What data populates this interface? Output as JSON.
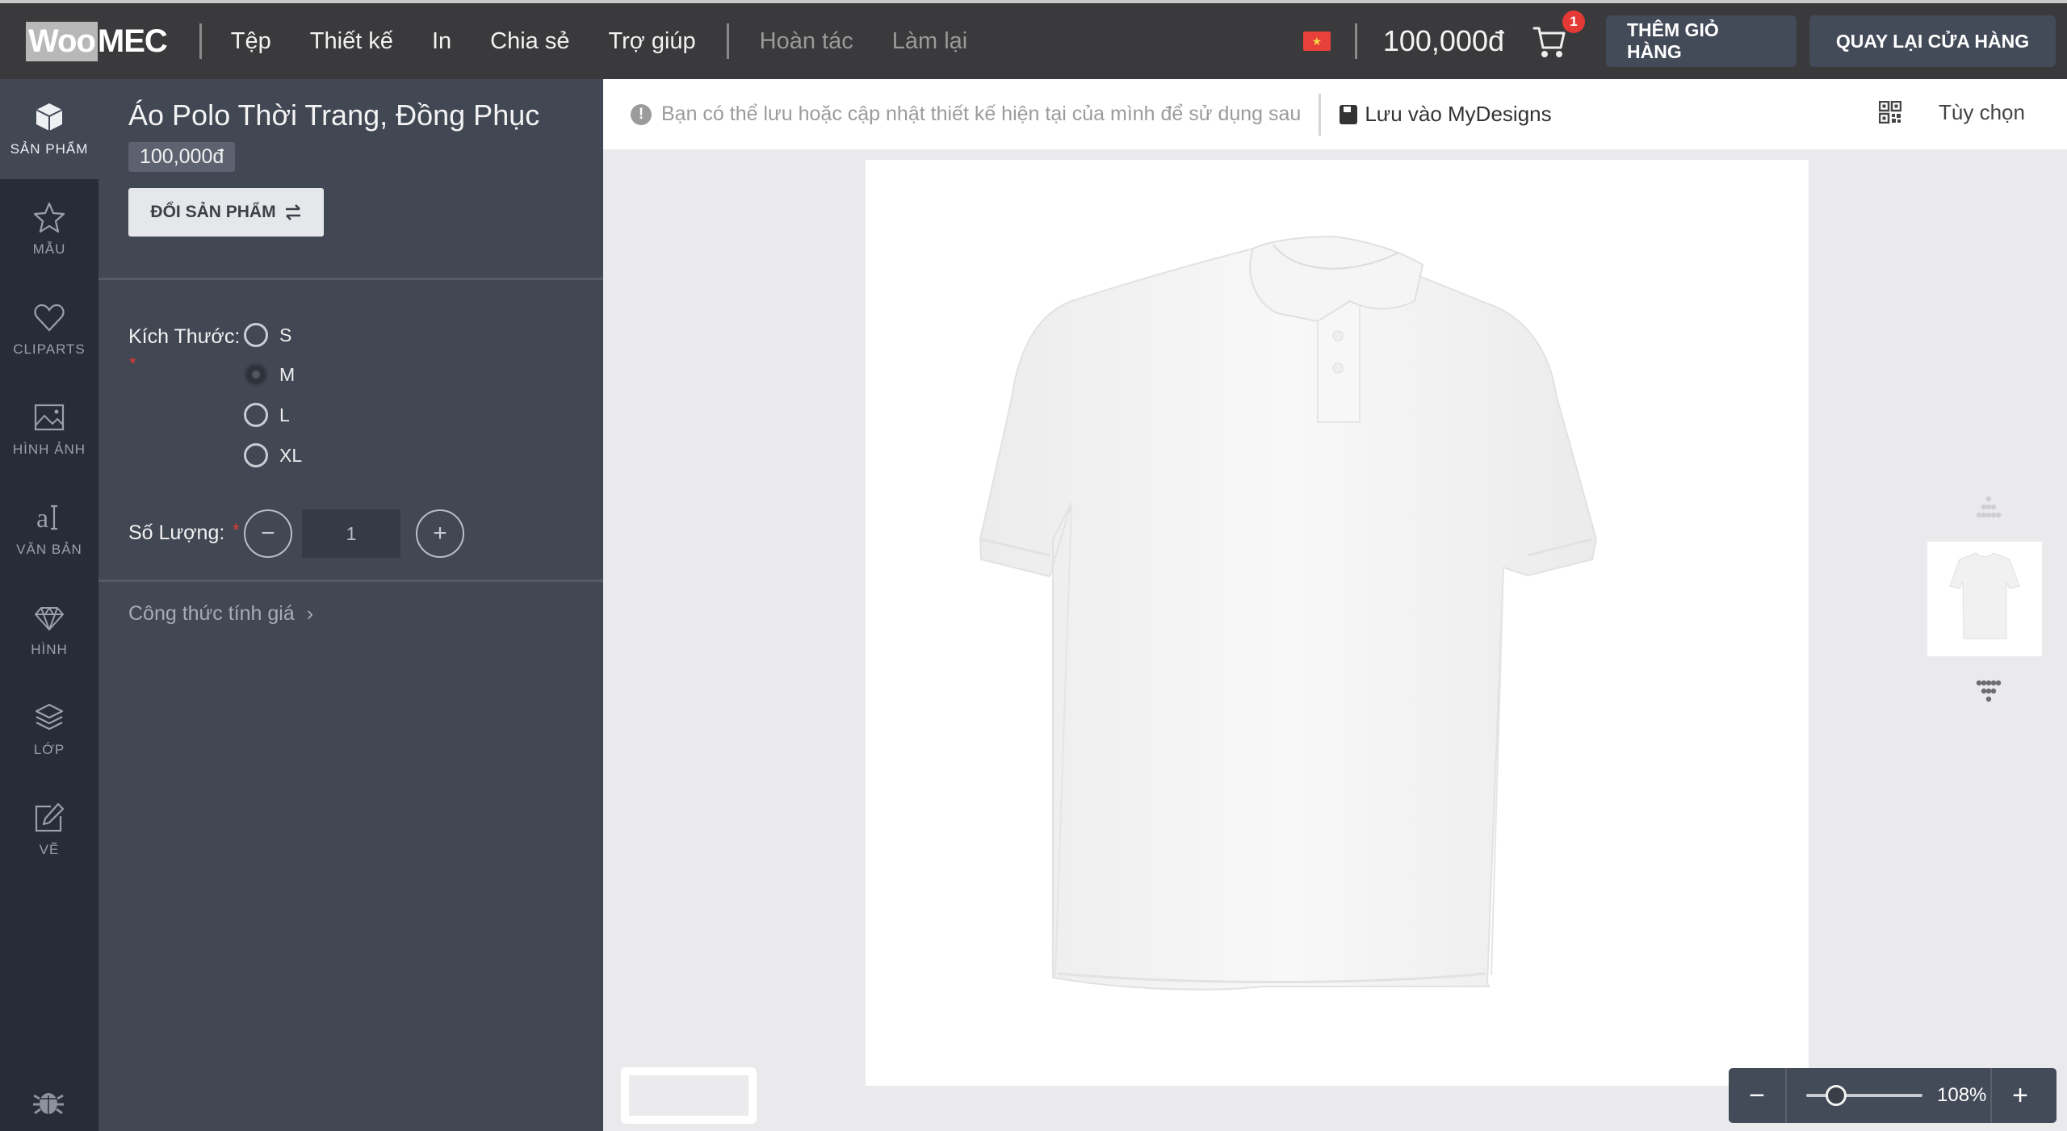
{
  "header": {
    "logo_part1": "Woo",
    "logo_part2": "MEC",
    "menu": [
      "Tệp",
      "Thiết kế",
      "In",
      "Chia sẻ",
      "Trợ giúp"
    ],
    "undo": "Hoàn tác",
    "redo": "Làm lại",
    "flag_icon": "vietnam-flag-icon",
    "total_price": "100,000đ",
    "cart_count": "1",
    "add_to_cart": "THÊM GIỎ HÀNG",
    "back_to_shop": "QUAY LẠI CỬA HÀNG"
  },
  "sidebar": {
    "items": [
      {
        "label": "SẢN PHẨM",
        "icon": "cube-icon",
        "active": true
      },
      {
        "label": "MẪU",
        "icon": "star-icon"
      },
      {
        "label": "CLIPARTS",
        "icon": "heart-icon"
      },
      {
        "label": "HÌNH ẢNH",
        "icon": "image-icon"
      },
      {
        "label": "VĂN BẢN",
        "icon": "text-icon"
      },
      {
        "label": "HÌNH",
        "icon": "diamond-icon"
      },
      {
        "label": "LỚP",
        "icon": "layers-icon"
      },
      {
        "label": "VẼ",
        "icon": "edit-icon"
      }
    ],
    "bottom_icon": "bug-icon"
  },
  "panel": {
    "product_title": "Áo Polo Thời Trang, Đồng Phục",
    "product_price": "100,000đ",
    "change_product": "ĐỔI SẢN PHẨM",
    "size_label": "Kích Thước:",
    "required_mark": "*",
    "sizes": [
      "S",
      "M",
      "L",
      "XL"
    ],
    "selected_size": "M",
    "quantity_label": "Số Lượng:",
    "quantity_value": "1",
    "pricing_formula": "Công thức tính giá"
  },
  "toolbar": {
    "info_text": "Bạn có thể lưu hoặc cập nhật thiết kế hiện tại của mình để sử dụng sau",
    "save_label": "Lưu vào MyDesigns",
    "options_label": "Tùy chọn"
  },
  "zoom": {
    "label": "108%",
    "slider_fraction": 0.2,
    "minus": "−",
    "plus": "+"
  },
  "colors": {
    "header_bg": "#3a3a3c",
    "sidebar_bg": "#282c37",
    "panel_bg": "#424754",
    "button_bg": "#434a58",
    "badge": "#e53935"
  }
}
